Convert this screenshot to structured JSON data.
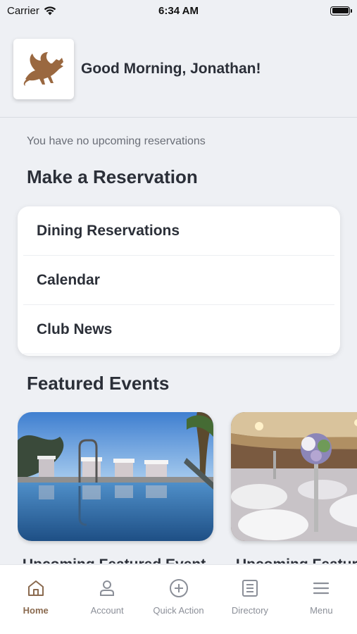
{
  "status_bar": {
    "carrier": "Carrier",
    "time": "6:34 AM"
  },
  "header": {
    "greeting": "Good Morning, Jonathan!",
    "logo_icon": "dragon-logo"
  },
  "reservations": {
    "empty_message": "You have no upcoming reservations",
    "section_title": "Make a Reservation",
    "items": [
      {
        "label": "Dining Reservations"
      },
      {
        "label": "Calendar"
      },
      {
        "label": "Club News"
      }
    ]
  },
  "featured": {
    "section_title": "Featured Events",
    "events": [
      {
        "title": "Upcoming Featured Event",
        "image": "pool-cabanas"
      },
      {
        "title": "Upcoming Featured Event",
        "image": "banquet-hall"
      }
    ]
  },
  "tab_bar": {
    "accent_color": "#8a6a4f",
    "tabs": [
      {
        "label": "Home",
        "icon": "home-icon",
        "active": true
      },
      {
        "label": "Account",
        "icon": "account-icon",
        "active": false
      },
      {
        "label": "Quick Action",
        "icon": "plus-circle-icon",
        "active": false
      },
      {
        "label": "Directory",
        "icon": "directory-icon",
        "active": false
      },
      {
        "label": "Menu",
        "icon": "hamburger-icon",
        "active": false
      }
    ]
  }
}
